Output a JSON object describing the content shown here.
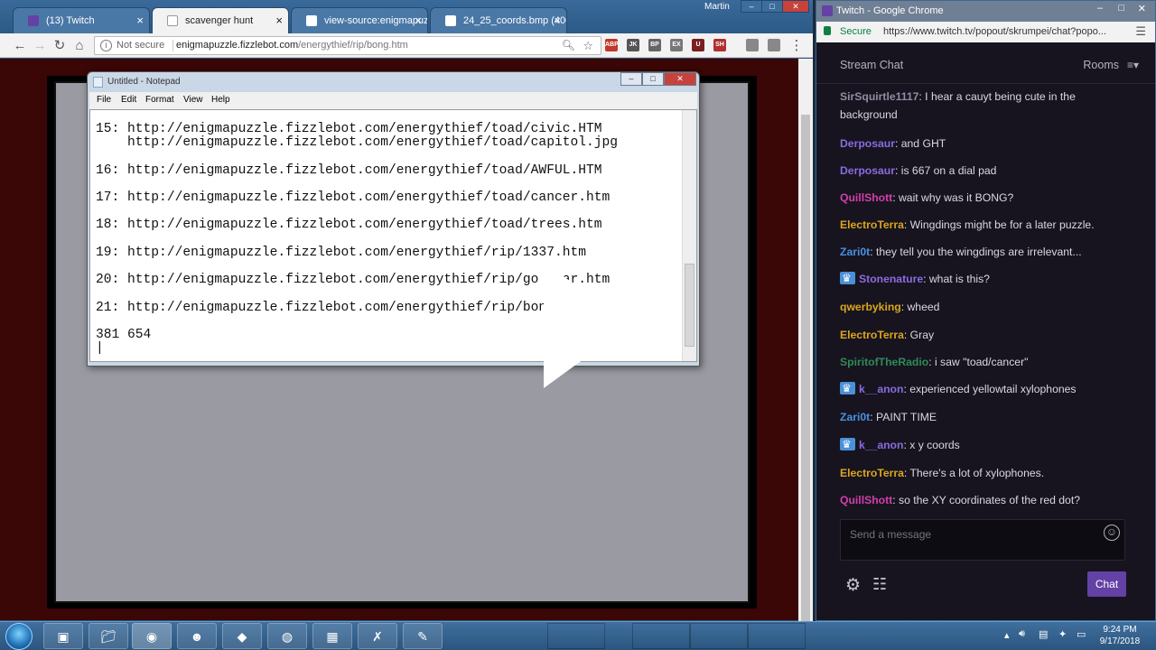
{
  "left_browser": {
    "tabs": [
      {
        "label": "(13) Twitch",
        "favicon_color": "#6441a5"
      },
      {
        "label": "scavenger hunt",
        "favicon_color": "#ffffff"
      },
      {
        "label": "view-source:enigmapuzz",
        "favicon_color": "#ffffff"
      },
      {
        "label": "24_25_coords.bmp (400×",
        "favicon_color": "#ffffff"
      }
    ],
    "profile_name": "Martin",
    "security_label": "Not secure",
    "url_host": "enigmapuzzle.fizzlebot.com",
    "url_path": "/energythief/rip/bong.htm",
    "extensions": [
      "ABP",
      "JK",
      "BP",
      "EX",
      "U",
      "SH"
    ]
  },
  "notepad": {
    "title": "Untitled - Notepad",
    "menu": [
      "File",
      "Edit",
      "Format",
      "View",
      "Help"
    ],
    "lines": [
      "15: http://enigmapuzzle.fizzlebot.com/energythief/toad/civic.HTM",
      "    http://enigmapuzzle.fizzlebot.com/energythief/toad/capitol.jpg",
      "",
      "16: http://enigmapuzzle.fizzlebot.com/energythief/toad/AWFUL.HTM",
      "",
      "17: http://enigmapuzzle.fizzlebot.com/energythief/toad/cancer.htm",
      "",
      "18: http://enigmapuzzle.fizzlebot.com/energythief/toad/trees.htm",
      "",
      "19: http://enigmapuzzle.fizzlebot.com/energythief/rip/1337.htm",
      "",
      "20: http://enigmapuzzle.fizzlebot.com/energythief/rip/go   ar.htm",
      "",
      "21: http://enigmapuzzle.fizzlebot.com/energythief/rip/bon",
      "",
      "381 654",
      "|"
    ]
  },
  "twitch_window": {
    "title": "Twitch - Google Chrome",
    "security_label": "Secure",
    "url": "https://www.twitch.tv/popout/skrumpei/chat?popo...",
    "chat_title": "Stream Chat",
    "rooms_label": "Rooms",
    "messages": [
      {
        "user": "SirSquirtle1117",
        "color": "#8e8ea3",
        "badge": false,
        "text": "I hear a cauyt being cute in the background"
      },
      {
        "user": "Derposaur",
        "color": "#8a6be0",
        "badge": false,
        "text": "and GHT"
      },
      {
        "user": "Derposaur",
        "color": "#8a6be0",
        "badge": false,
        "text": "is 667 on a dial pad"
      },
      {
        "user": "QuillShott",
        "color": "#d33fa8",
        "badge": false,
        "text": "wait why was it BONG?"
      },
      {
        "user": "ElectroTerra",
        "color": "#daa520",
        "badge": false,
        "text": "Wingdings might be for a later puzzle."
      },
      {
        "user": "Zari0t",
        "color": "#4a90e2",
        "badge": false,
        "text": "they tell you the wingdings are irrelevant..."
      },
      {
        "user": "Stonenature",
        "color": "#8a6be0",
        "badge": true,
        "text": "what is this?"
      },
      {
        "user": "qwerbyking",
        "color": "#daa520",
        "badge": false,
        "text": "wheed"
      },
      {
        "user": "ElectroTerra",
        "color": "#daa520",
        "badge": false,
        "text": "Gray"
      },
      {
        "user": "SpiritofTheRadio",
        "color": "#2e8b57",
        "badge": false,
        "text": "i saw \"toad/cancer\""
      },
      {
        "user": "k__anon",
        "color": "#8a6be0",
        "badge": true,
        "text": "experienced yellowtail xylophones"
      },
      {
        "user": "Zari0t",
        "color": "#4a90e2",
        "badge": false,
        "text": "PAINT TIME"
      },
      {
        "user": "k__anon",
        "color": "#8a6be0",
        "badge": true,
        "text": "x y coords"
      },
      {
        "user": "ElectroTerra",
        "color": "#daa520",
        "badge": false,
        "text": "There's a lot of xylophones."
      },
      {
        "user": "QuillShott",
        "color": "#d33fa8",
        "badge": false,
        "text": "so the XY coordinates of the red dot?"
      }
    ],
    "input_placeholder": "Send a message",
    "chat_button": "Chat"
  },
  "taskbar": {
    "apps": [
      "explorer",
      "chrome",
      "discord",
      "app",
      "obs",
      "calculator",
      "app2",
      "paint"
    ],
    "clock_time": "9:24 PM",
    "clock_date": "9/17/2018"
  },
  "colors": {
    "twitch_purple": "#6441a5",
    "page_dark_red": "#3a0606"
  }
}
